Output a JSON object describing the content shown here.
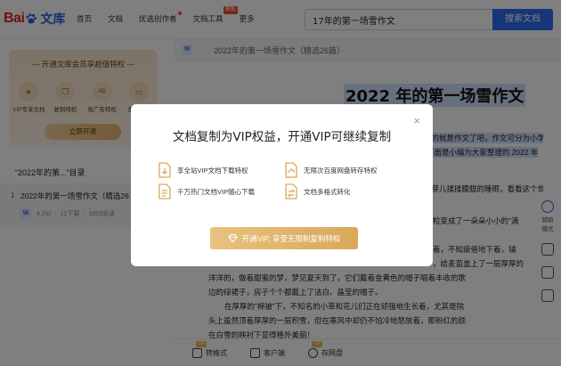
{
  "header": {
    "logo_text": "Bai",
    "logo_product": "文库",
    "nav": [
      {
        "label": "首页"
      },
      {
        "label": "文档"
      },
      {
        "label": "优选创作者"
      },
      {
        "label": "文档工具",
        "badge": "限免"
      },
      {
        "label": "更多"
      }
    ],
    "search": {
      "value": "17年的第一场雪作文",
      "button": "搜索文档"
    }
  },
  "sidebar": {
    "vip_title": "— 开通文库会员享超值特权 —",
    "features": [
      {
        "label": "VIP专享文档",
        "icon": "star-icon",
        "glyph": "★"
      },
      {
        "label": "复制特权",
        "icon": "copy-icon",
        "glyph": "❐"
      },
      {
        "label": "免广告特权",
        "icon": "ad-icon",
        "glyph": "AD"
      },
      {
        "label": "多端特权",
        "icon": "devices-icon",
        "glyph": "▭"
      }
    ],
    "open_button": "立即开通",
    "toc_title": "“2022年的第...”目录",
    "toc_items": [
      {
        "num": "1",
        "name": "2022年的第一场雪作文（精选26",
        "rating": "4.2分",
        "pages": "12下载",
        "reads": "1653阅读"
      }
    ]
  },
  "document": {
    "header_title": "2022年的第一场雪作文（精选26篇）",
    "title": "2022 年的第一场雪作文",
    "lines": [
      {
        "text": "生的就是作文了吧，作文可分为小学",
        "hl": true
      },
      {
        "text": "”下面是小编为大家整理的 2022 年",
        "hl": true
      },
      {
        "text": "的芽儿揉揉朦胧的睡眼，看看这个世",
        "hl": false
      },
      {
        "text": "粒变成了一朵朵小小的”满",
        "hl": false
      },
      {
        "text": "着，不知疲倦地下着，铺",
        "hl": false
      },
      {
        "text": "，给麦苗盖上了一层厚厚的",
        "hl": false
      },
      {
        "text": "洋洋的，做着甜蜜的梦，梦见夏天到了，它们戴着金黄色的帽子唱着丰收的歌",
        "hl": false
      },
      {
        "text": "边的绿裙子，房子个个都戴上了洁白、晶莹的帽子。",
        "hl": false
      },
      {
        "text": "在厚厚的”棉被”下，不知名的小草和花儿们正在顽强地生长着，尤其是院",
        "hl": false
      },
      {
        "text": "头上虽然顶着厚厚的一层积雪，但在寒风中却仍不怕冷地怒放着，那粉红的颜",
        "hl": false
      },
      {
        "text": "在白雪的映衬下显得格外美丽！",
        "hl": false
      }
    ],
    "right_tools": [
      {
        "label": "辅助\n模式"
      },
      {
        "label": ""
      },
      {
        "label": ""
      },
      {
        "label": ""
      }
    ],
    "bottom_bar": [
      {
        "label": "转格式",
        "vip": "VIP"
      },
      {
        "label": "客户端",
        "vip": ""
      },
      {
        "label": "存网盘",
        "vip": "VIP"
      }
    ]
  },
  "modal": {
    "title": "文档复制为VIP权益，开通VIP可继续复制",
    "perks": [
      {
        "label": "享全站VIP文档下载特权",
        "icon": "download-doc-icon"
      },
      {
        "label": "无限次百度网盘转存特权",
        "icon": "netdisk-icon"
      },
      {
        "label": "千万热门文档VIP随心下载",
        "icon": "hot-doc-icon"
      },
      {
        "label": "文档多格式转化",
        "icon": "convert-icon"
      }
    ],
    "button": "开通VIP, 享受无限制复制特权",
    "close": "×"
  }
}
